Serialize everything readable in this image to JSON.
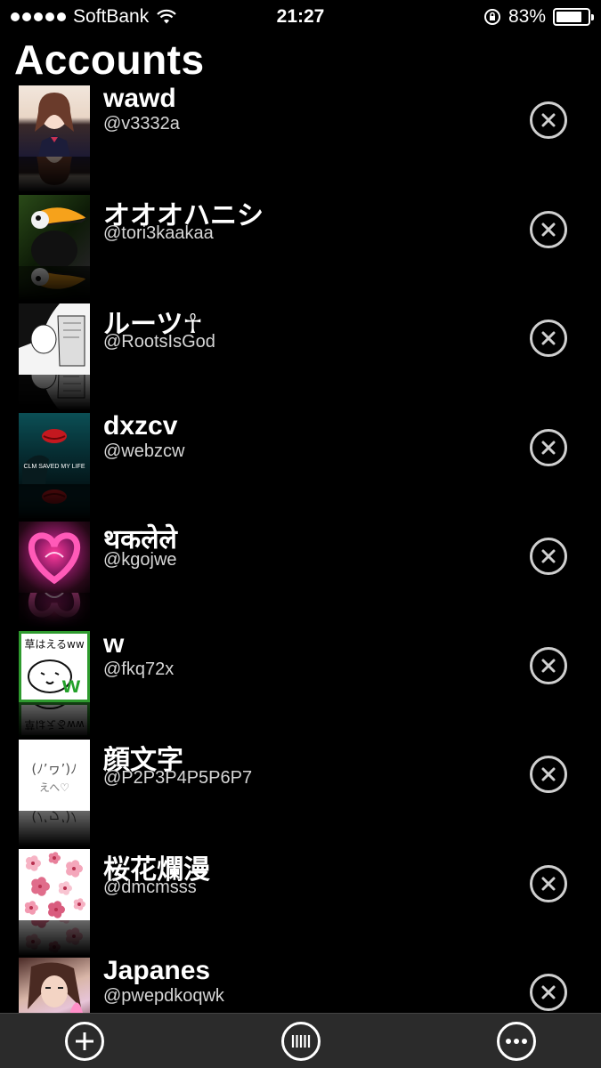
{
  "status_bar": {
    "carrier": "SoftBank",
    "time": "21:27",
    "battery_percent": "83%",
    "battery_level": 0.83
  },
  "page_title": "Accounts",
  "accounts": [
    {
      "name": "wawd",
      "handle": "@v3332a",
      "avatar": "av-girl"
    },
    {
      "name": "オオオハニシ",
      "handle": "@tori3kaakaa",
      "avatar": "av-toucan"
    },
    {
      "name": "ルーツ☥",
      "handle": "@RootsIsGod",
      "avatar": "av-manga"
    },
    {
      "name": "dxzcv",
      "handle": "@webzcw",
      "avatar": "av-lips"
    },
    {
      "name": "थकलेले",
      "handle": "@kgojwe",
      "avatar": "av-heart"
    },
    {
      "name": "w",
      "handle": "@fkq72x",
      "avatar": "av-w"
    },
    {
      "name": "顔文字",
      "handle": "@P2P3P4P5P6P7",
      "avatar": "av-kao"
    },
    {
      "name": "桜花爛漫",
      "handle": "@dmcmsss",
      "avatar": "av-sakura"
    },
    {
      "name": "Japanes",
      "handle": "@pwepdkoqwk",
      "avatar": "av-japanes"
    }
  ],
  "avatar_text": {
    "lips": "CLM SAVED MY LIFE",
    "w_caption": "草はえるww",
    "w_letter": "w",
    "kao_face": "(ﾉ’ヮ’)ﾉ",
    "kao_sub": "えへ♡"
  },
  "tab_bar": {
    "add_icon": "plus-icon",
    "columns_icon": "columns-icon",
    "more_icon": "more-icon"
  }
}
